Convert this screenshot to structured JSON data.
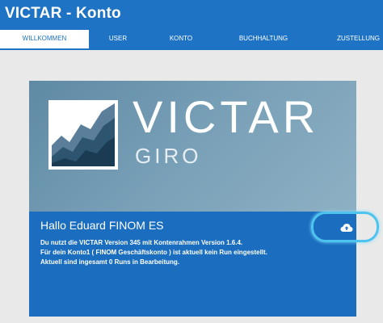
{
  "app": {
    "title": "VICTAR - Konto"
  },
  "tabs": [
    {
      "label": "WILLKOMMEN",
      "active": true
    },
    {
      "label": "USER"
    },
    {
      "label": "KONTO"
    },
    {
      "label": "BUCHHALTUNG"
    },
    {
      "label": "ZUSTELLUNG"
    }
  ],
  "hero": {
    "logo_text": "VICTAR",
    "logo_subtext": "GIRO"
  },
  "panel": {
    "greeting": "Hallo Eduard FINOM ES",
    "lines": [
      "Du nutzt die VICTAR Version 345 mit Kontenrahmen Version 1.6.4.",
      "Für dein Konto1 ( FINOM Geschäftskonto ) ist aktuell kein Run eingestellt.",
      "Aktuell sind ingesamt 0 Runs in Bearbeitung."
    ],
    "action_icon": "cloud-upload-icon"
  },
  "colors": {
    "primary": "#1e73c4",
    "panel": "#1a6dbf",
    "highlight": "#4ec3ee",
    "background": "#e9e9e9"
  }
}
